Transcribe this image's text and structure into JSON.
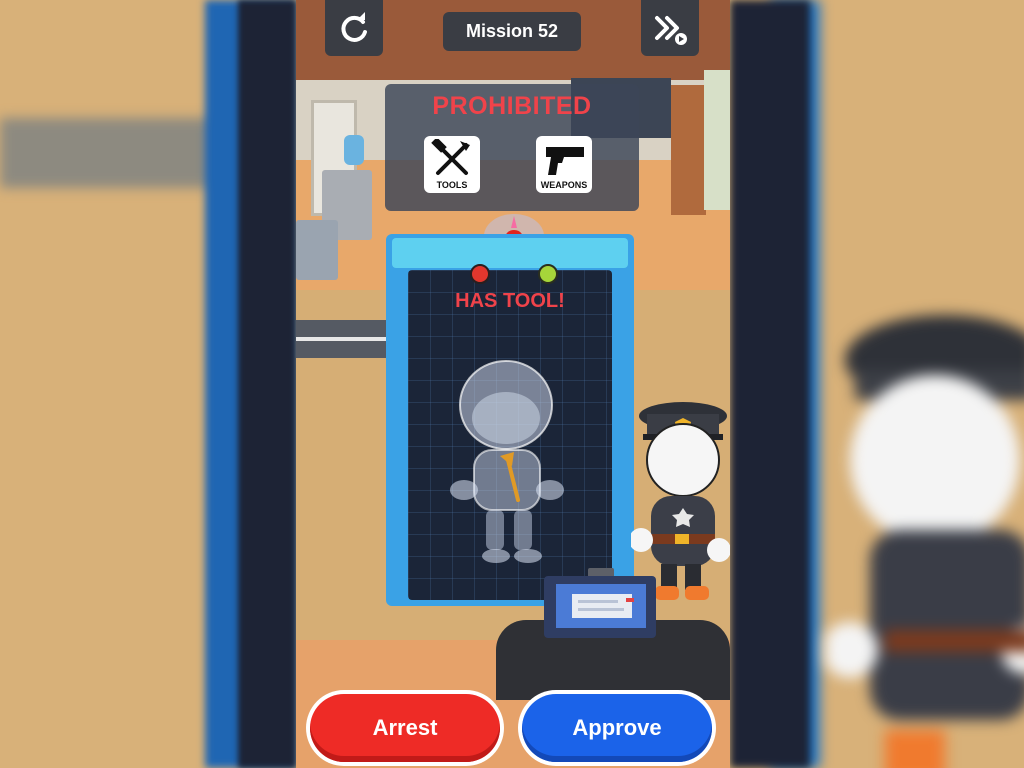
{
  "hud": {
    "restart_icon": "restart-icon",
    "mission_label": "Mission 52",
    "skip_icon": "skip-ad-icon"
  },
  "prohibited": {
    "title": "PROHIBITED",
    "items": [
      {
        "label": "TOOLS",
        "icon": "tools-icon"
      },
      {
        "label": "WEAPONS",
        "icon": "pistol-icon"
      }
    ]
  },
  "scanner": {
    "status": "HAS TOOL!",
    "detected_item": "axe"
  },
  "actions": {
    "arrest_label": "Arrest",
    "approve_label": "Approve"
  },
  "colors": {
    "alert_red": "#f0434a",
    "arrest": "#ee2b26",
    "approve": "#1b63e9",
    "scanner_frame": "#3aa2e6"
  }
}
